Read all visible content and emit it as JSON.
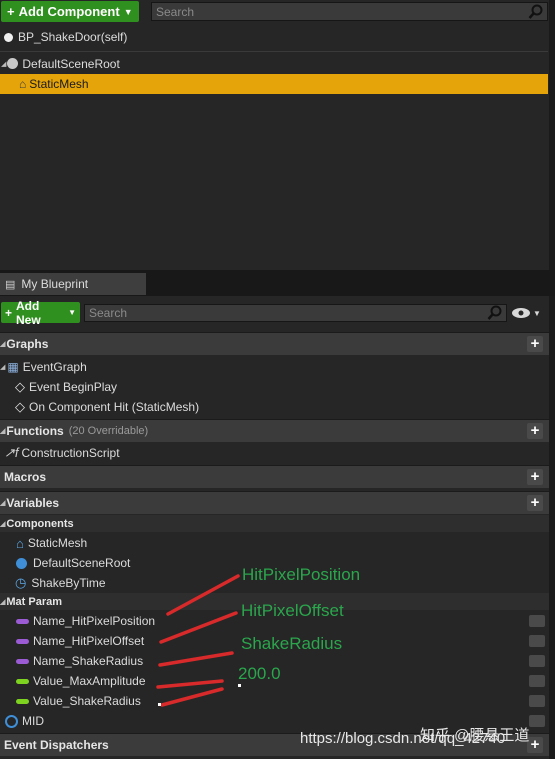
{
  "components_panel": {
    "add_button_label": "Add Component",
    "search_placeholder": "Search",
    "self_item": "BP_ShakeDoor(self)",
    "tree": [
      {
        "label": "DefaultSceneRoot"
      },
      {
        "label": "StaticMesh",
        "selected": true
      }
    ]
  },
  "my_blueprint": {
    "tab_label": "My Blueprint",
    "add_new_label": "Add New",
    "search_placeholder": "Search",
    "graphs": {
      "header": "Graphs",
      "items": [
        "EventGraph",
        "Event BeginPlay",
        "On Component Hit (StaticMesh)"
      ]
    },
    "functions": {
      "header": "Functions",
      "overridable": "(20 Overridable)",
      "items": [
        "ConstructionScript"
      ]
    },
    "macros": {
      "header": "Macros"
    },
    "variables": {
      "header": "Variables",
      "components_header": "Components",
      "components": [
        "StaticMesh",
        "DefaultSceneRoot",
        "ShakeByTime"
      ],
      "mat_param_header": "Mat Param",
      "mat_params": [
        {
          "name": "Name_HitPixelPosition",
          "type_color": "#9b5bd4"
        },
        {
          "name": "Name_HitPixelOffset",
          "type_color": "#9b5bd4"
        },
        {
          "name": "Name_ShakeRadius",
          "type_color": "#9b5bd4"
        },
        {
          "name": "Value_MaxAmplitude",
          "type_color": "#7ed321"
        },
        {
          "name": "Value_ShakeRadius",
          "type_color": "#7ed321"
        }
      ],
      "mid": "MID"
    },
    "event_dispatchers": {
      "header": "Event Dispatchers"
    }
  },
  "annotations": [
    "HitPixelPosition",
    "HitPixelOffset",
    "ShakeRadius",
    "200.0"
  ],
  "watermark": {
    "left": "https://blog.csdn.net/qq_42740",
    "right": "知乎 @腰悬王道"
  },
  "colors": {
    "selection": "#e5a50a",
    "add_green": "#2f8f1f",
    "annotation_green": "#2aa64c",
    "annotation_line": "#d82a2a"
  }
}
